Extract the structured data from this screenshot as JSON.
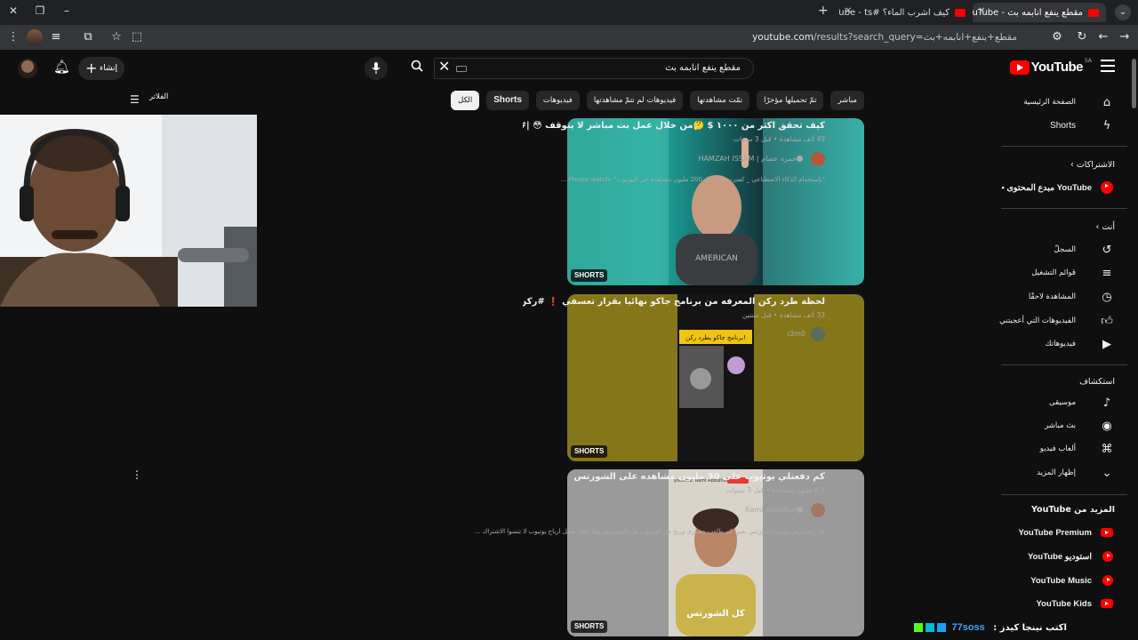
{
  "browser": {
    "tabs": [
      {
        "title": "مقطع ينفع انابمه بث - YouTube",
        "active": true
      },
      {
        "title": "كيف اشرب الماء؟ #YouTube - ts",
        "active": false
      }
    ],
    "url_host": "youtube.com",
    "url_path": "/results?search_query=مقطع+ينفع+انابمه+بث"
  },
  "header": {
    "logo_text": "YouTube",
    "region": "SA",
    "search_value": "مقطع ينفع انابمه بث",
    "create_label": "إنشاء"
  },
  "chips": [
    {
      "label": "الكل",
      "active": true
    },
    {
      "label": "Shorts",
      "active": false
    },
    {
      "label": "فيديوهات",
      "active": false
    },
    {
      "label": "فيديوهات لم تتمّ مشاهدتها",
      "active": false
    },
    {
      "label": "تمّت مشاهدتها",
      "active": false
    },
    {
      "label": "تمّ تحميلها مؤخرًا",
      "active": false
    },
    {
      "label": "مباشر",
      "active": false
    }
  ],
  "filters_label": "الفلاتر",
  "sidebar": {
    "home": "الصفحة الرئيسية",
    "shorts": "Shorts",
    "subscriptions": "الاشتراكات",
    "subscription_item": "YouTube مبدع المحتوى •",
    "you": "أنت",
    "history": "السجلّ",
    "playlists": "قوائم التشغيل",
    "watch_later": "المشاهدة لاحقًا",
    "liked": "الفيديوهات التي أعجبتني",
    "your_videos": "فيديوهاتك",
    "explore": "استكشاف",
    "music": "موسيقى",
    "live": "بث مباشر",
    "gaming": "ألعاب فيديو",
    "show_more": "إظهار المزيد",
    "more_from": "المزيد من YouTube",
    "premium": "YouTube Premium",
    "studio": "استوديو YouTube",
    "yt_music": "YouTube Music",
    "kids": "YouTube Kids"
  },
  "results": [
    {
      "title": "كيف تحقق اكثر من ١٠٠٠ $ 🤔من خلال عمل بث مباشر لا يتوقف 😳 |#حمزه_عصام",
      "meta": "49 ألف مشاهدة • قبل 3 سنوات",
      "channel": "حمزه عصام | HAMZAH ISSAM",
      "description": "\"بإستخدام الذكاء الاصطناعي _ كسرت حاجز الـ 200 مليون مشاهدة عبر اليوتيوب\" :Please watch ...",
      "badge": "SHORTS"
    },
    {
      "title": "لحظة طرد ركن المعرفه من برنامج جاكو نهائيا بقرار تعسفي ❗ #ركن_المعرفة #جاكو #",
      "meta": "33 ألف مشاهدة • قبل سنتين",
      "channel": "i3m0",
      "badge": "SHORTS"
    },
    {
      "title": "كم دفعتلي يوتيوب على 30 مليون مشاهده على الشورتس",
      "meta": "6.5 مليون مشاهدة • قبل 3 سنوات",
      "channel": "Rami Abdulhai",
      "description": "كم ربحت من يوتيوب شورتس يعني كم طلعت مصاري وربح من اليوتيوب من الشورتس وهل فيك تعمل ارباح يوتيوب لا تنسوا الاشتراك ...",
      "badge": "SHORTS"
    }
  ],
  "thumb_overlays": {
    "t2_caption": "برنامج جاكو يطرد ركن!",
    "t3_caption": "كل الشورتس",
    "t3_topline": "youtube: Rami Abdulhai"
  },
  "overlay": {
    "label": "اكتب نينجا كيدز :",
    "handle": "77soss"
  },
  "colors": {
    "accent": "#ff0000",
    "bg": "#0f0f0f",
    "link": "#3ea6ff"
  }
}
